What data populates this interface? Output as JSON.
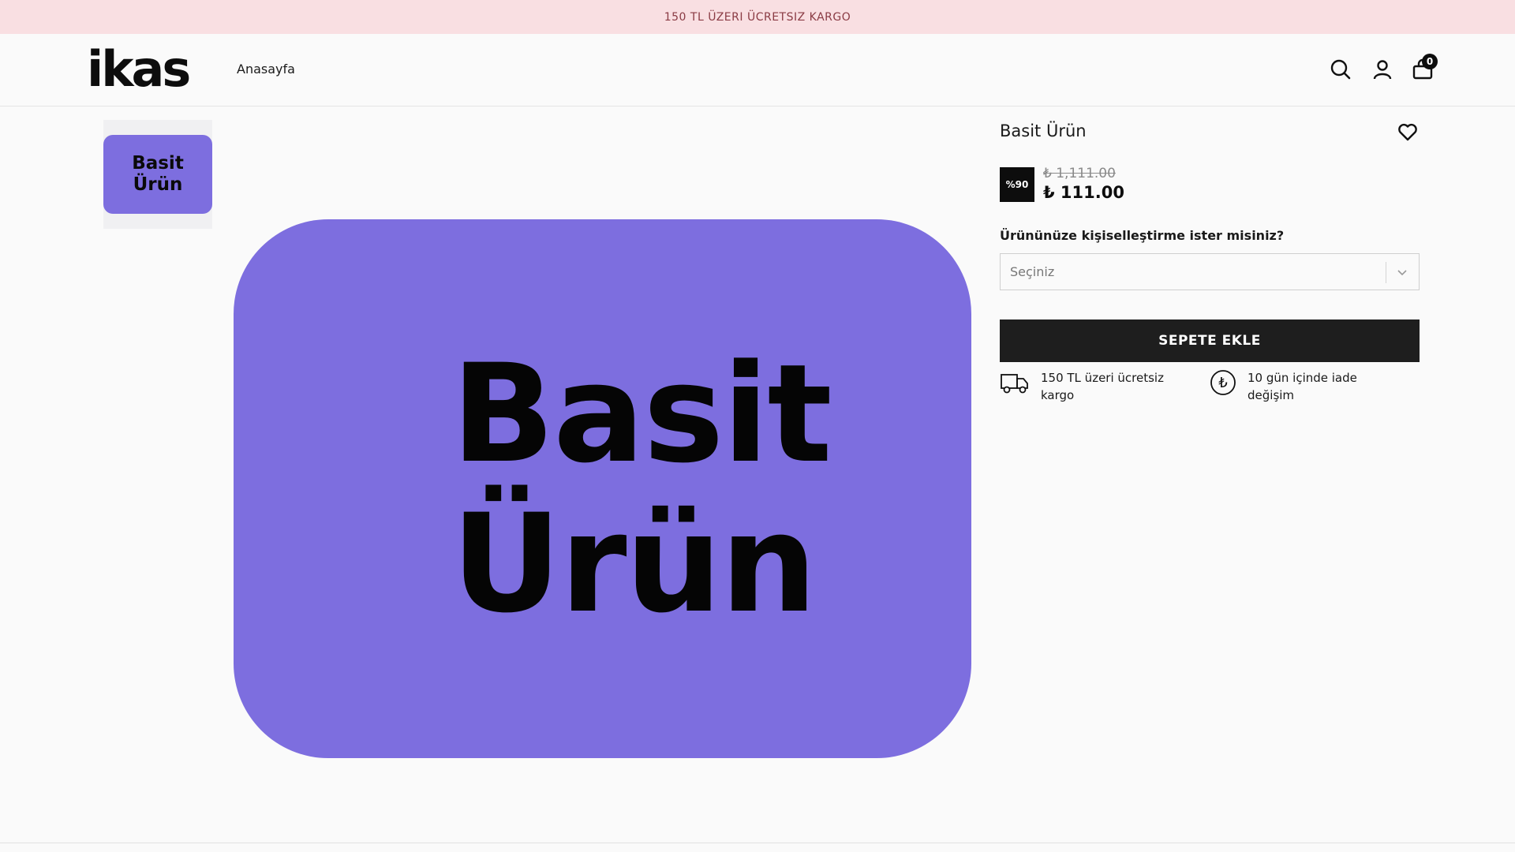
{
  "announcement": {
    "text": "150 TL ÜZERI ÜCRETSIZ KARGO"
  },
  "header": {
    "logo": "ikas",
    "nav": [
      {
        "label": "Anasayfa"
      }
    ],
    "cart_count": "0",
    "icons": [
      "search-icon",
      "user-icon",
      "cart-icon"
    ]
  },
  "gallery": {
    "thumbnail": {
      "line1": "Basit",
      "line2": "Ürün"
    },
    "main": {
      "line1": "Basit",
      "line2": "Ürün"
    },
    "image_color": "#7d6edf"
  },
  "product": {
    "title": "Basit Ürün",
    "discount_badge": "%90",
    "old_price": "₺ 1,111.00",
    "price": "₺ 111.00",
    "personalization_question": "Ürününüze kişiselleştirme ister misiniz?",
    "select": {
      "value": "Seçiniz"
    },
    "add_to_cart": "SEPETE EKLE",
    "features": [
      {
        "icon": "truck-icon",
        "text": "150 TL üzeri ücretsiz kargo"
      },
      {
        "icon": "lira-icon",
        "text": "10 gün içinde iade değişim"
      }
    ]
  },
  "colors": {
    "announcement_bg": "#f9dfe2",
    "accent_purple": "#7d6edf",
    "button_bg": "#1e1e1e"
  }
}
